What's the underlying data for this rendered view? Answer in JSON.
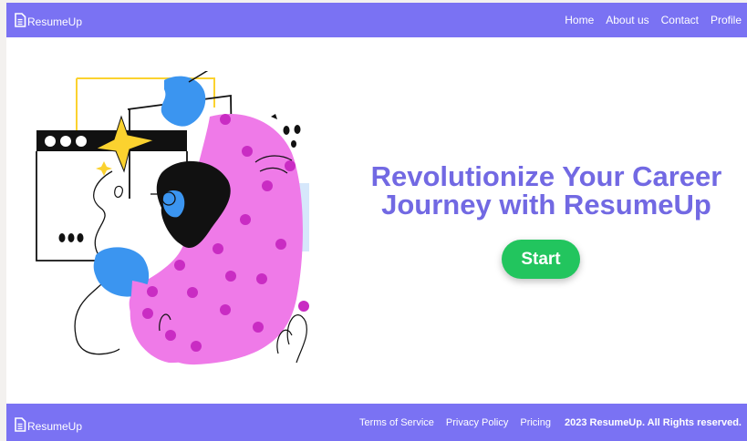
{
  "header": {
    "brand": "ResumeUp",
    "nav": [
      "Home",
      "About us",
      "Contact",
      "Profile"
    ]
  },
  "hero": {
    "title": "Revolutionize Your Career Journey with ResumeUp",
    "cta": "Start",
    "illustration": "woman-working-at-screen-illustration"
  },
  "footer": {
    "brand": "ResumeUp",
    "links": [
      "Terms of Service",
      "Privacy Policy",
      "Pricing"
    ],
    "copyright": "2023 ResumeUp. All Rights reserved."
  },
  "colors": {
    "header_bg": "#7a72f3",
    "accent_text": "#7269e3",
    "cta_bg": "#22c55e",
    "illustration_pink": "#ef7ae8",
    "illustration_blue": "#3b95f0",
    "illustration_yellow": "#fbd22f"
  }
}
